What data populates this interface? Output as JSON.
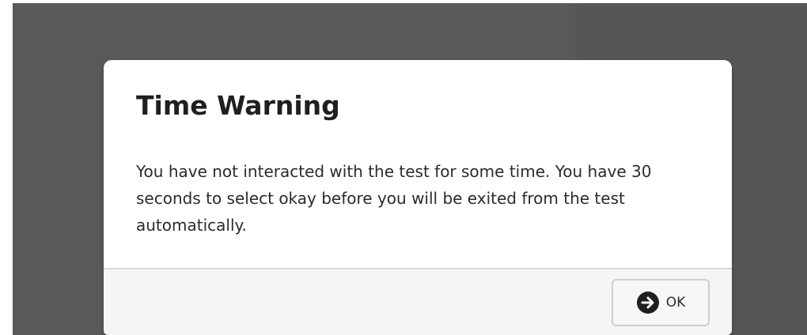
{
  "dialog": {
    "title": "Time Warning",
    "message": "You have not interacted with the test for some time. You have 30 seconds to select okay before you will be exited from the test automatically.",
    "ok_label": "OK",
    "ok_icon": "arrow-right-circle-icon"
  },
  "colors": {
    "backdrop": "#58595b",
    "dialog_background": "#ffffff",
    "footer_background": "#f5f5f5",
    "button_border": "#cfcfcf",
    "text": "#1f1f1f"
  }
}
